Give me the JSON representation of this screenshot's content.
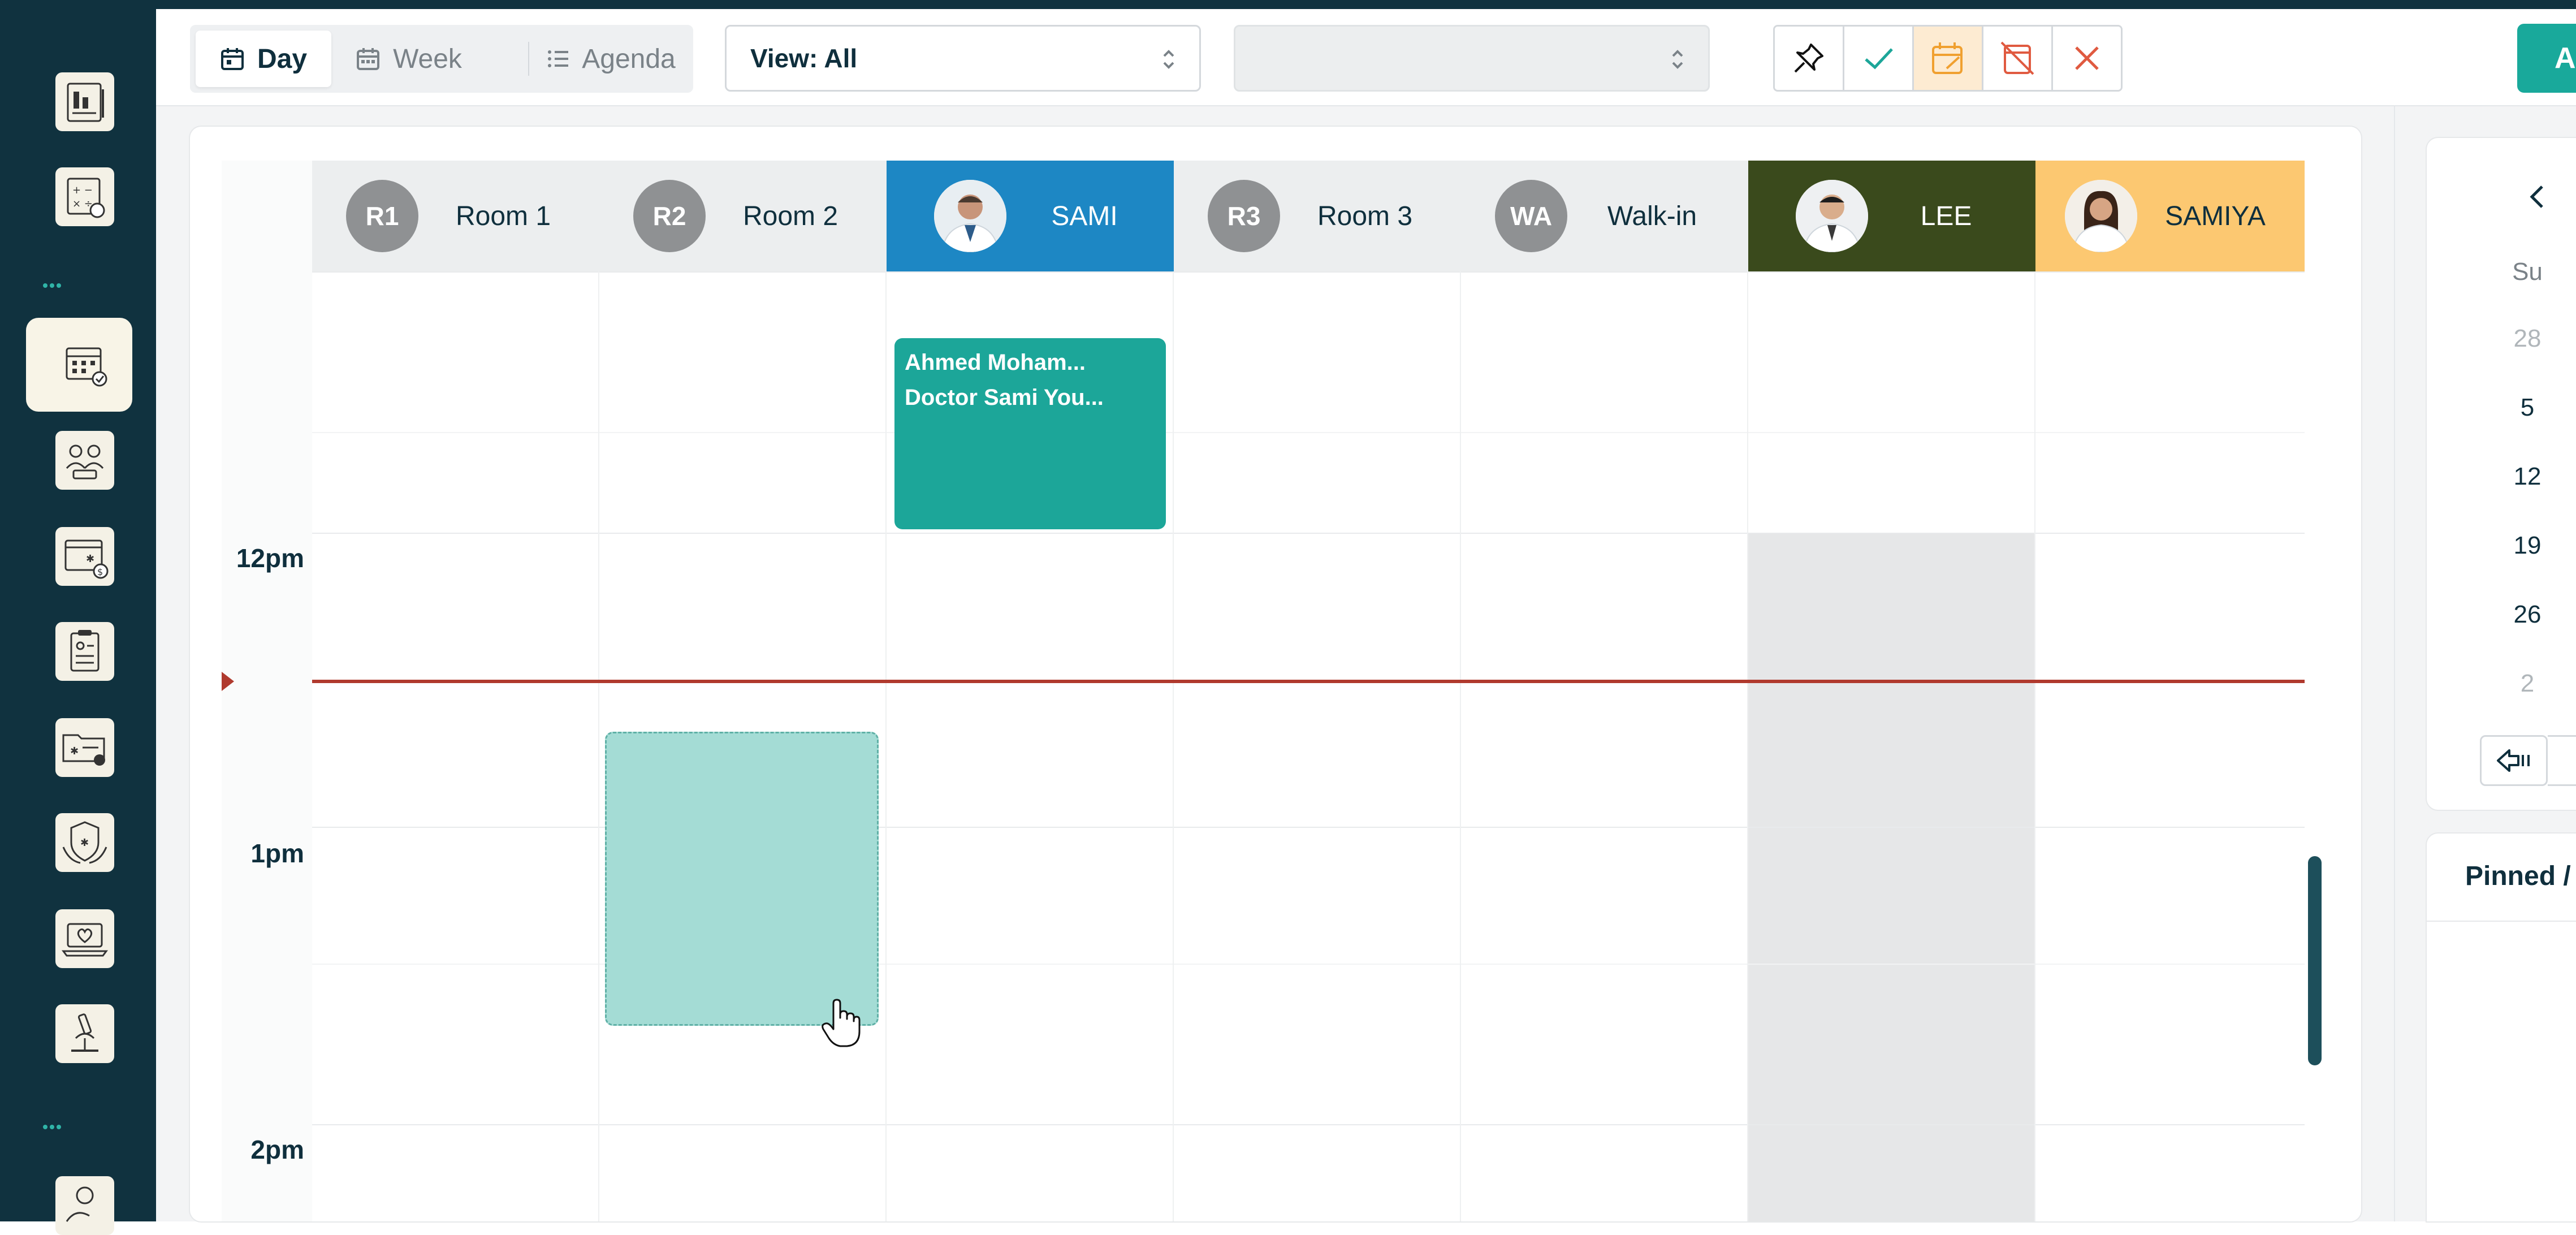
{
  "toolbar": {
    "tabs": {
      "day": "Day",
      "week": "Week",
      "agenda": "Agenda"
    },
    "view_select": "View: All",
    "secondary_select": "",
    "add_button": "A"
  },
  "columns": [
    {
      "avatar": "R1",
      "name": "Room 1"
    },
    {
      "avatar": "R2",
      "name": "Room 2"
    },
    {
      "avatar": "",
      "name": "SAMI"
    },
    {
      "avatar": "R3",
      "name": "Room 3"
    },
    {
      "avatar": "WA",
      "name": "Walk-in"
    },
    {
      "avatar": "",
      "name": "LEE"
    },
    {
      "avatar": "",
      "name": "SAMIYA"
    }
  ],
  "time_labels": [
    "12pm",
    "1pm",
    "2pm"
  ],
  "appointment": {
    "line1": "Ahmed Moham...",
    "line2": "Doctor Sami You..."
  },
  "colors": {
    "sami": "#1d87c4",
    "lee": "#3a4a1c",
    "samiya": "#fcc871",
    "accent": "#1ca699",
    "now_line": "#b03a2e"
  },
  "mini_calendar": {
    "weekday": "Su",
    "days": [
      "28",
      "5",
      "12",
      "19",
      "26",
      "2"
    ]
  },
  "pinned": {
    "title": "Pinned /"
  }
}
